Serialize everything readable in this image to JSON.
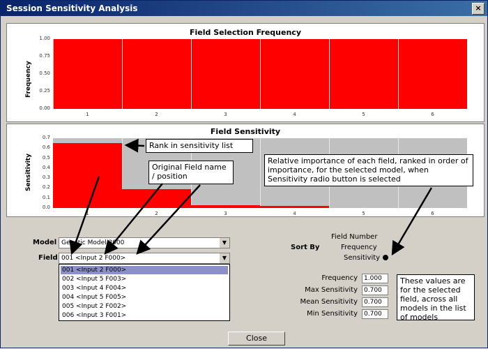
{
  "window": {
    "title": "Session Sensitivity Analysis",
    "close_glyph": "×"
  },
  "chart_data": [
    {
      "type": "bar",
      "title": "Field Selection Frequency",
      "ylabel": "Frequency",
      "xlabel": "",
      "categories": [
        "1",
        "2",
        "3",
        "4",
        "5",
        "6"
      ],
      "values": [
        1.0,
        1.0,
        1.0,
        1.0,
        1.0,
        1.0
      ],
      "yticks": [
        "1.00",
        "0.75",
        "0.50",
        "0.25",
        "0.00"
      ],
      "ylim": [
        0,
        1.0
      ],
      "grid": true,
      "bar_color": "#ff0000",
      "background_color": "#c0c0c0"
    },
    {
      "type": "bar",
      "title": "Field Sensitivity",
      "ylabel": "Sensitivity",
      "xlabel": "",
      "categories": [
        "1",
        "2",
        "3",
        "4",
        "5",
        "6"
      ],
      "values": [
        0.7,
        0.2,
        0.03,
        0.02,
        0.0,
        0.0
      ],
      "yticks": [
        "0.7",
        "0.6",
        "0.5",
        "0.4",
        "0.3",
        "0.2",
        "0.1",
        "0.0"
      ],
      "ylim": [
        0,
        0.75
      ],
      "grid": true,
      "bar_color": "#ff0000",
      "background_color": "#c0c0c0"
    }
  ],
  "callouts": {
    "rank": "Rank in sensitivity list",
    "original": "Original Field name / position",
    "relative": "Relative importance of each field, ranked in order of importance, for the selected model, when Sensitivity radio button is selected",
    "values": "These values are for the selected field, across all models in the list of models"
  },
  "controls": {
    "model_label": "Model",
    "model_value": "Genetic Model 3000",
    "field_label": "Field",
    "field_value": "001 <Input 2 F000>",
    "field_options": [
      "001 <Input 2 F000>",
      "002 <Input 5 F003>",
      "003 <Input 4 F004>",
      "004 <Input 5 F005>",
      "005 <Input 2 F002>",
      "006 <Input 3 F001>"
    ],
    "selected_option_index": 0,
    "sort_label": "Sort By",
    "sort_options": [
      "Field Number",
      "Frequency",
      "Sensitivity"
    ],
    "sort_selected": "Sensitivity",
    "stats": [
      {
        "label": "Frequency",
        "value": "1.000"
      },
      {
        "label": "Max Sensitivity",
        "value": "0.700"
      },
      {
        "label": "Mean Sensitivity",
        "value": "0.700"
      },
      {
        "label": "Min Sensitivity",
        "value": "0.700"
      }
    ],
    "close_label": "Close"
  }
}
